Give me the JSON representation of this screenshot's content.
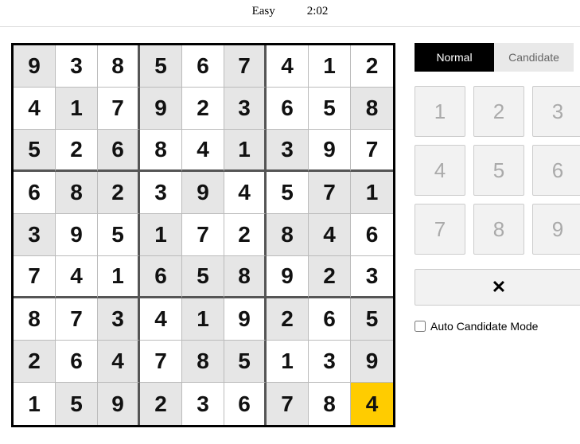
{
  "header": {
    "difficulty": "Easy",
    "timer": "2:02"
  },
  "board": {
    "rows": [
      [
        {
          "v": "9",
          "g": true
        },
        {
          "v": "3",
          "g": false
        },
        {
          "v": "8",
          "g": false
        },
        {
          "v": "5",
          "g": true
        },
        {
          "v": "6",
          "g": false
        },
        {
          "v": "7",
          "g": true
        },
        {
          "v": "4",
          "g": false
        },
        {
          "v": "1",
          "g": false
        },
        {
          "v": "2",
          "g": false
        }
      ],
      [
        {
          "v": "4",
          "g": false
        },
        {
          "v": "1",
          "g": true
        },
        {
          "v": "7",
          "g": false
        },
        {
          "v": "9",
          "g": true
        },
        {
          "v": "2",
          "g": false
        },
        {
          "v": "3",
          "g": true
        },
        {
          "v": "6",
          "g": false
        },
        {
          "v": "5",
          "g": false
        },
        {
          "v": "8",
          "g": true
        }
      ],
      [
        {
          "v": "5",
          "g": true
        },
        {
          "v": "2",
          "g": false
        },
        {
          "v": "6",
          "g": true
        },
        {
          "v": "8",
          "g": false
        },
        {
          "v": "4",
          "g": false
        },
        {
          "v": "1",
          "g": true
        },
        {
          "v": "3",
          "g": true
        },
        {
          "v": "9",
          "g": false
        },
        {
          "v": "7",
          "g": false
        }
      ],
      [
        {
          "v": "6",
          "g": false
        },
        {
          "v": "8",
          "g": true
        },
        {
          "v": "2",
          "g": true
        },
        {
          "v": "3",
          "g": false
        },
        {
          "v": "9",
          "g": true
        },
        {
          "v": "4",
          "g": false
        },
        {
          "v": "5",
          "g": false
        },
        {
          "v": "7",
          "g": true
        },
        {
          "v": "1",
          "g": true
        }
      ],
      [
        {
          "v": "3",
          "g": true
        },
        {
          "v": "9",
          "g": false
        },
        {
          "v": "5",
          "g": false
        },
        {
          "v": "1",
          "g": true
        },
        {
          "v": "7",
          "g": false
        },
        {
          "v": "2",
          "g": false
        },
        {
          "v": "8",
          "g": true
        },
        {
          "v": "4",
          "g": true
        },
        {
          "v": "6",
          "g": false
        }
      ],
      [
        {
          "v": "7",
          "g": false
        },
        {
          "v": "4",
          "g": false
        },
        {
          "v": "1",
          "g": false
        },
        {
          "v": "6",
          "g": true
        },
        {
          "v": "5",
          "g": true
        },
        {
          "v": "8",
          "g": true
        },
        {
          "v": "9",
          "g": false
        },
        {
          "v": "2",
          "g": true
        },
        {
          "v": "3",
          "g": false
        }
      ],
      [
        {
          "v": "8",
          "g": false
        },
        {
          "v": "7",
          "g": false
        },
        {
          "v": "3",
          "g": true
        },
        {
          "v": "4",
          "g": false
        },
        {
          "v": "1",
          "g": true
        },
        {
          "v": "9",
          "g": false
        },
        {
          "v": "2",
          "g": true
        },
        {
          "v": "6",
          "g": false
        },
        {
          "v": "5",
          "g": true
        }
      ],
      [
        {
          "v": "2",
          "g": true
        },
        {
          "v": "6",
          "g": false
        },
        {
          "v": "4",
          "g": true
        },
        {
          "v": "7",
          "g": false
        },
        {
          "v": "8",
          "g": true
        },
        {
          "v": "5",
          "g": true
        },
        {
          "v": "1",
          "g": false
        },
        {
          "v": "3",
          "g": false
        },
        {
          "v": "9",
          "g": true
        }
      ],
      [
        {
          "v": "1",
          "g": false
        },
        {
          "v": "5",
          "g": true
        },
        {
          "v": "9",
          "g": true
        },
        {
          "v": "2",
          "g": true
        },
        {
          "v": "3",
          "g": false
        },
        {
          "v": "6",
          "g": false
        },
        {
          "v": "7",
          "g": true
        },
        {
          "v": "8",
          "g": false
        },
        {
          "v": "4",
          "g": false,
          "sel": true
        }
      ]
    ]
  },
  "tabs": {
    "normal": "Normal",
    "candidate": "Candidate"
  },
  "keypad": [
    "1",
    "2",
    "3",
    "4",
    "5",
    "6",
    "7",
    "8",
    "9"
  ],
  "clear_label": "✕",
  "auto_label": "Auto Candidate Mode"
}
